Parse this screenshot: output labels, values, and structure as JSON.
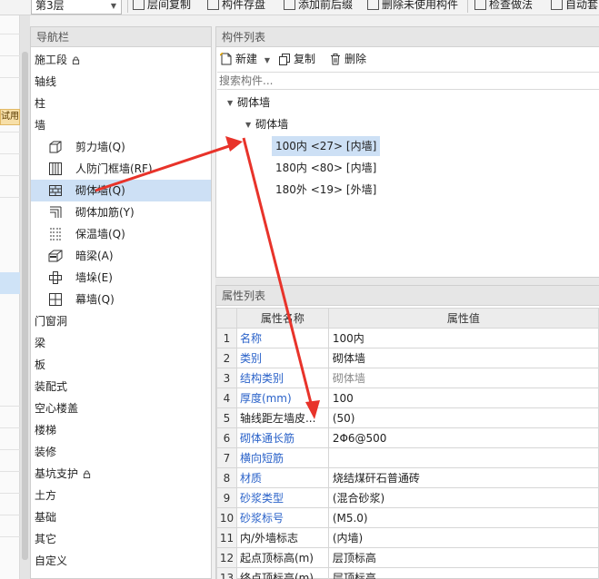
{
  "toolbar": {
    "floor": "第3层",
    "buttons": [
      "层间复制",
      "构件存盘",
      "添加前后缀",
      "删除未使用构件",
      "检查做法",
      "自动套"
    ]
  },
  "edge": {
    "badge": "试用"
  },
  "nav": {
    "title": "导航栏",
    "items": [
      "施工段",
      "轴线",
      "柱",
      "墙",
      "门窗洞",
      "梁",
      "板",
      "装配式",
      "空心楼盖",
      "楼梯",
      "装修",
      "基坑支护",
      "土方",
      "基础",
      "其它",
      "自定义"
    ],
    "wall_sub": [
      {
        "label": "剪力墙(Q)",
        "icon": "shear-wall-icon"
      },
      {
        "label": "人防门框墙(RF)",
        "icon": "civil-defense-door-frame-wall-icon"
      },
      {
        "label": "砌体墙(Q)",
        "icon": "masonry-wall-icon"
      },
      {
        "label": "砌体加筋(Y)",
        "icon": "masonry-reinforcement-icon"
      },
      {
        "label": "保温墙(Q)",
        "icon": "insulation-wall-icon"
      },
      {
        "label": "暗梁(A)",
        "icon": "hidden-beam-icon"
      },
      {
        "label": "墙垛(E)",
        "icon": "wall-pier-icon"
      },
      {
        "label": "幕墙(Q)",
        "icon": "curtain-wall-icon"
      }
    ],
    "selected_sub": 2
  },
  "components": {
    "title": "构件列表",
    "new_label": "新建",
    "copy_label": "复制",
    "delete_label": "删除",
    "search_placeholder": "搜索构件...",
    "tree_root": "砌体墙",
    "tree_child": "砌体墙",
    "leaves": [
      "100内 <27> [内墙]",
      "180内 <80> [内墙]",
      "180外 <19> [外墙]"
    ],
    "selected_leaf": 0
  },
  "properties": {
    "title": "属性列表",
    "col_name": "属性名称",
    "col_value": "属性值",
    "rows": [
      {
        "n": "1",
        "name": "名称",
        "value": "100内",
        "blue": true
      },
      {
        "n": "2",
        "name": "类别",
        "value": "砌体墙",
        "blue": true
      },
      {
        "n": "3",
        "name": "结构类别",
        "value": "砌体墙",
        "blue": true,
        "grey": true
      },
      {
        "n": "4",
        "name": "厚度(mm)",
        "value": "100",
        "blue": true
      },
      {
        "n": "5",
        "name": "轴线距左墙皮...",
        "value": "(50)",
        "blue": false
      },
      {
        "n": "6",
        "name": "砌体通长筋",
        "value": "2Φ6@500",
        "blue": true
      },
      {
        "n": "7",
        "name": "横向短筋",
        "value": "",
        "blue": true
      },
      {
        "n": "8",
        "name": "材质",
        "value": "烧结煤矸石普通砖",
        "blue": true
      },
      {
        "n": "9",
        "name": "砂浆类型",
        "value": "(混合砂浆)",
        "blue": true
      },
      {
        "n": "10",
        "name": "砂浆标号",
        "value": "(M5.0)",
        "blue": true
      },
      {
        "n": "11",
        "name": "内/外墙标志",
        "value": "(内墙)",
        "blue": false
      },
      {
        "n": "12",
        "name": "起点顶标高(m)",
        "value": "层顶标高",
        "blue": false
      },
      {
        "n": "13",
        "name": "终点顶标高(m)",
        "value": "层顶标高",
        "blue": false
      }
    ]
  },
  "colors": {
    "selection": "#cde0f5",
    "link_blue": "#2a62c9",
    "arrow_red": "#e8332a"
  }
}
